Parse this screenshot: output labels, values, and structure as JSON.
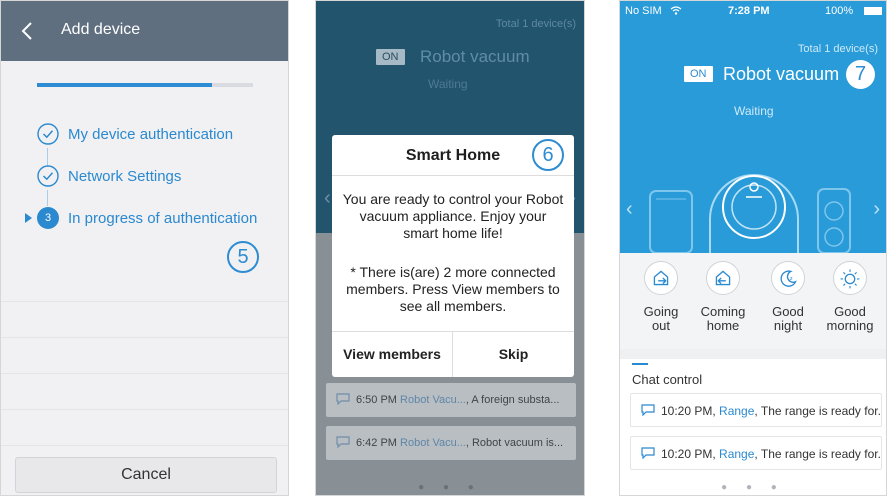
{
  "screen1": {
    "title": "Add device",
    "progress_fraction": 0.81,
    "steps": [
      {
        "label": "My device authentication",
        "state": "done"
      },
      {
        "label": "Network Settings",
        "state": "done"
      },
      {
        "label": "In progress of authentication",
        "state": "current",
        "number": "3"
      }
    ],
    "callout_number": "5",
    "cancel_label": "Cancel"
  },
  "screen2": {
    "total_label": "Total 1 device(s)",
    "on_badge": "ON",
    "device_name": "Robot vacuum",
    "status": "Waiting",
    "dialog": {
      "title": "Smart Home",
      "callout_number": "6",
      "message": "You are ready to control your Robot vacuum appliance. Enjoy your smart home life!",
      "note": "* There is(are) 2 more connected members. Press View members to see all members.",
      "view_members_label": "View members",
      "skip_label": "Skip"
    },
    "chats": [
      {
        "time": "6:50 PM",
        "sender": "Robot Vacu...",
        "text": ", A foreign substa..."
      },
      {
        "time": "6:42 PM",
        "sender": "Robot Vacu...",
        "text": ", Robot vacuum is..."
      }
    ],
    "page_dots": "● ● ●"
  },
  "screen3": {
    "carrier": "No SIM",
    "time": "7:28 PM",
    "battery": "100%",
    "total_label": "Total 1 device(s)",
    "on_badge": "ON",
    "device_name": "Robot vacuum",
    "callout_number": "7",
    "status": "Waiting",
    "modes": [
      {
        "label_line1": "Going",
        "label_line2": "out",
        "icon": "going-out-icon"
      },
      {
        "label_line1": "Coming",
        "label_line2": "home",
        "icon": "coming-home-icon"
      },
      {
        "label_line1": "Good",
        "label_line2": "night",
        "icon": "good-night-icon"
      },
      {
        "label_line1": "Good",
        "label_line2": "morning",
        "icon": "good-morning-icon"
      }
    ],
    "chat_title": "Chat control",
    "chats": [
      {
        "time": "10:20 PM",
        "sender": "Range",
        "text": ", The range is ready for..."
      },
      {
        "time": "10:20 PM",
        "sender": "Range",
        "text": ", The range is ready for..."
      }
    ],
    "page_dots": "● ● ●",
    "colors": {
      "accent": "#2a89cf",
      "header": "#299bd8"
    }
  }
}
